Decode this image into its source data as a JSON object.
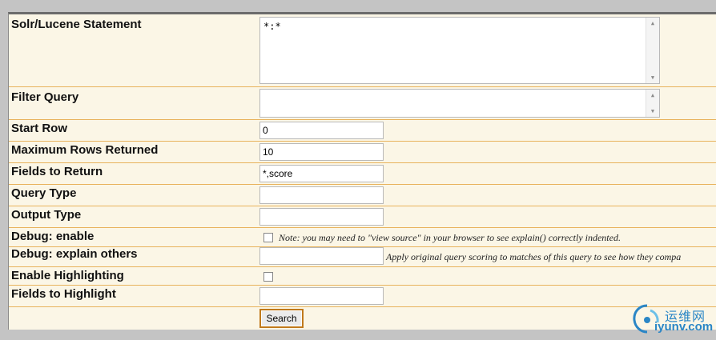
{
  "form": {
    "solr_statement": {
      "label": "Solr/Lucene Statement",
      "value": "*:*"
    },
    "filter_query": {
      "label": "Filter Query",
      "value": ""
    },
    "start_row": {
      "label": "Start Row",
      "value": "0"
    },
    "max_rows": {
      "label": "Maximum Rows Returned",
      "value": "10"
    },
    "fields_return": {
      "label": "Fields to Return",
      "value": "*,score"
    },
    "query_type": {
      "label": "Query Type",
      "value": ""
    },
    "output_type": {
      "label": "Output Type",
      "value": ""
    },
    "debug_enable": {
      "label": "Debug: enable",
      "checked": false,
      "note": "Note: you may need to \"view source\" in your browser to see explain() correctly indented."
    },
    "debug_explain": {
      "label": "Debug: explain others",
      "value": "",
      "note": "Apply original query scoring to matches of this query to see how they compa"
    },
    "highlighting": {
      "label": "Enable Highlighting",
      "checked": false
    },
    "fields_highlight": {
      "label": "Fields to Highlight",
      "value": ""
    },
    "search_button": {
      "label": "Search"
    }
  },
  "watermark": {
    "cn": "运维网",
    "url": "iyunv.com",
    "color": "#2a86c6"
  }
}
